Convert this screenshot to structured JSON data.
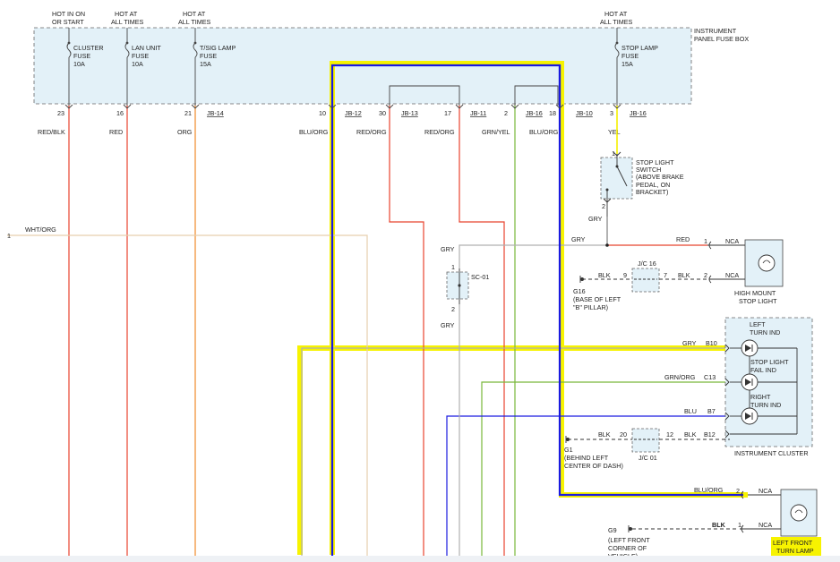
{
  "colors": {
    "fuse_box_fill": "#e3f1f8",
    "red": "#e8432e",
    "orange": "#ef8a2a",
    "tan": "#e6cfae",
    "gray": "#b0b0b0",
    "green": "#79b83a",
    "blue": "#1a1ae0",
    "yellow": "#f5f000",
    "highlight": "#f7f300"
  },
  "fuse_box": {
    "label_line1": "INSTRUMENT",
    "label_line2": "PANEL FUSE BOX"
  },
  "fuses": [
    {
      "hot1": "HOT IN ON",
      "hot2": "OR START",
      "name1": "CLUSTER",
      "name2": "FUSE",
      "rating": "10A",
      "pin": "23",
      "conn": "",
      "wire": "RED/BLK"
    },
    {
      "hot1": "HOT AT",
      "hot2": "ALL TIMES",
      "name1": "LAN UNIT",
      "name2": "FUSE",
      "rating": "10A",
      "pin": "16",
      "conn": "",
      "wire": "RED"
    },
    {
      "hot1": "HOT AT",
      "hot2": "ALL TIMES",
      "name1": "T/SIG LAMP",
      "name2": "FUSE",
      "rating": "15A",
      "pin": "21",
      "conn": "JB-14",
      "wire": "ORG"
    },
    {
      "hot1": "HOT AT",
      "hot2": "ALL TIMES",
      "name1": "STOP LAMP",
      "name2": "FUSE",
      "rating": "15A",
      "pin": "3",
      "conn": "JB-16",
      "wire": "YEL"
    }
  ],
  "jb_pins": [
    {
      "pin": "10",
      "conn": "JB-12",
      "wire": "BLU/ORG"
    },
    {
      "pin": "30",
      "conn": "JB-13",
      "wire": "RED/ORG"
    },
    {
      "pin": "17",
      "conn": "JB-11",
      "wire": "RED/ORG"
    },
    {
      "pin": "2",
      "conn": "JB-16",
      "wire": "GRN/YEL"
    },
    {
      "pin": "18",
      "conn": "JB-10",
      "wire": "BLU/ORG"
    }
  ],
  "left_wire": {
    "pin": "1",
    "color": "WHT/ORG"
  },
  "stop_switch": {
    "line1": "STOP LIGHT",
    "line2": "SWITCH",
    "line3": "(ABOVE BRAKE",
    "line4": "PEDAL, ON",
    "line5": "BRACKET)",
    "pin_top": "1",
    "pin_bottom": "2",
    "wire_out": "GRY"
  },
  "sc01": {
    "label": "SC-01",
    "pin_top": "1",
    "pin_bottom": "2",
    "wire_top": "GRY",
    "wire_bottom": "GRY"
  },
  "high_mount": {
    "label1": "HIGH MOUNT",
    "label2": "STOP LIGHT",
    "wire_in": "GRY",
    "wire_red": "RED",
    "pin1": "1",
    "nca": "NCA",
    "pin2": "2",
    "nca2": "NCA",
    "blk": "BLK"
  },
  "g16": {
    "label1": "G16",
    "label2": "(BASE OF LEFT",
    "label3": "\"B\" PILLAR)",
    "wire": "BLK",
    "jc_label": "J/C 16",
    "pin_left": "9",
    "pin_right": "7"
  },
  "cluster": {
    "title": "INSTRUMENT CLUSTER",
    "left_turn_1": "LEFT",
    "left_turn_2": "TURN IND",
    "stop_fail_1": "STOP LIGHT",
    "stop_fail_2": "FAIL IND",
    "right_turn_1": "RIGHT",
    "right_turn_2": "TURN IND",
    "pin_b10": "B10",
    "pin_c13": "C13",
    "pin_b7": "B7",
    "pin_b12": "B12",
    "wire_gry": "GRY",
    "wire_grn": "GRN/ORG",
    "wire_blu": "BLU",
    "wire_blk": "BLK"
  },
  "g1": {
    "label1": "G1",
    "label2": "(BEHIND LEFT",
    "label3": "CENTER OF DASH)",
    "wire": "BLK",
    "jc_label": "J/C 01",
    "pin_left": "20",
    "pin_right": "12"
  },
  "front_lamp": {
    "label1": "LEFT FRONT",
    "label2": "TURN LAMP",
    "wire_in": "BLU/ORG",
    "pin2": "2",
    "nca": "NCA",
    "blk": "BLK",
    "pin1": "1",
    "nca2": "NCA"
  },
  "g9": {
    "label1": "G9",
    "label2": "(LEFT FRONT",
    "label3": "CORNER OF",
    "label4": "VEHICLE)"
  }
}
